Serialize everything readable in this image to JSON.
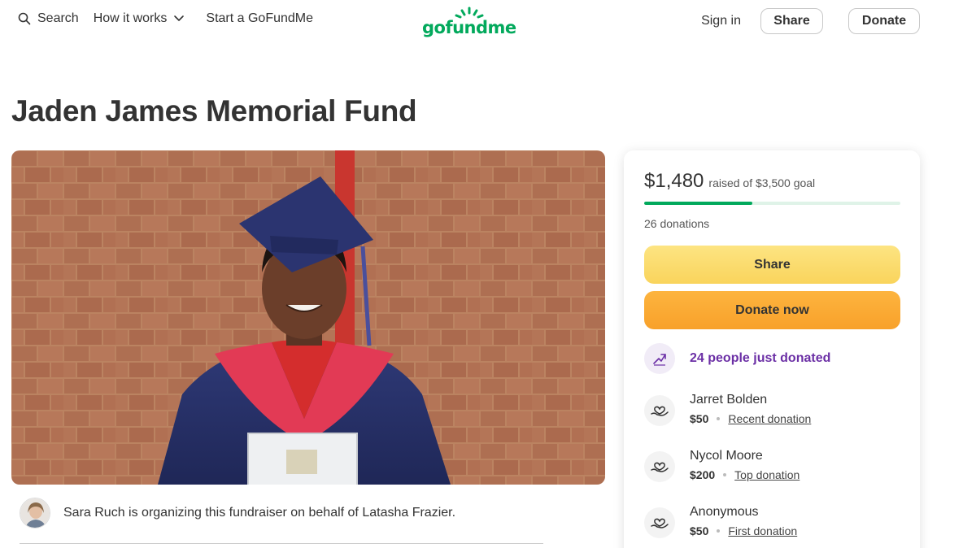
{
  "header": {
    "search_label": "Search",
    "how_it_works_label": "How it works",
    "start_label": "Start a GoFundMe",
    "logo_text": "gofundme",
    "signin_label": "Sign in",
    "share_label": "Share",
    "donate_label": "Donate",
    "brand_color": "#02a95c"
  },
  "campaign": {
    "title": "Jaden James Memorial Fund",
    "organizer_text": "Sara Ruch is organizing this fundraiser on behalf of Latasha Frazier."
  },
  "sidebar": {
    "raised_amount": "$1,480",
    "raised_goal": "raised of $3,500 goal",
    "progress_fraction": 0.423,
    "donations_count": "26 donations",
    "share_button": "Share",
    "donate_button": "Donate now",
    "trending_text": "24 people just donated",
    "donors": [
      {
        "name": "Jarret Bolden",
        "amount": "$50",
        "tag": "Recent donation"
      },
      {
        "name": "Nycol Moore",
        "amount": "$200",
        "tag": "Top donation"
      },
      {
        "name": "Anonymous",
        "amount": "$50",
        "tag": "First donation"
      }
    ]
  },
  "icons": {
    "search": "search-icon",
    "chevron": "chevron-down-icon",
    "trending": "trending-up-icon",
    "heart_hand": "heart-hand-icon"
  }
}
